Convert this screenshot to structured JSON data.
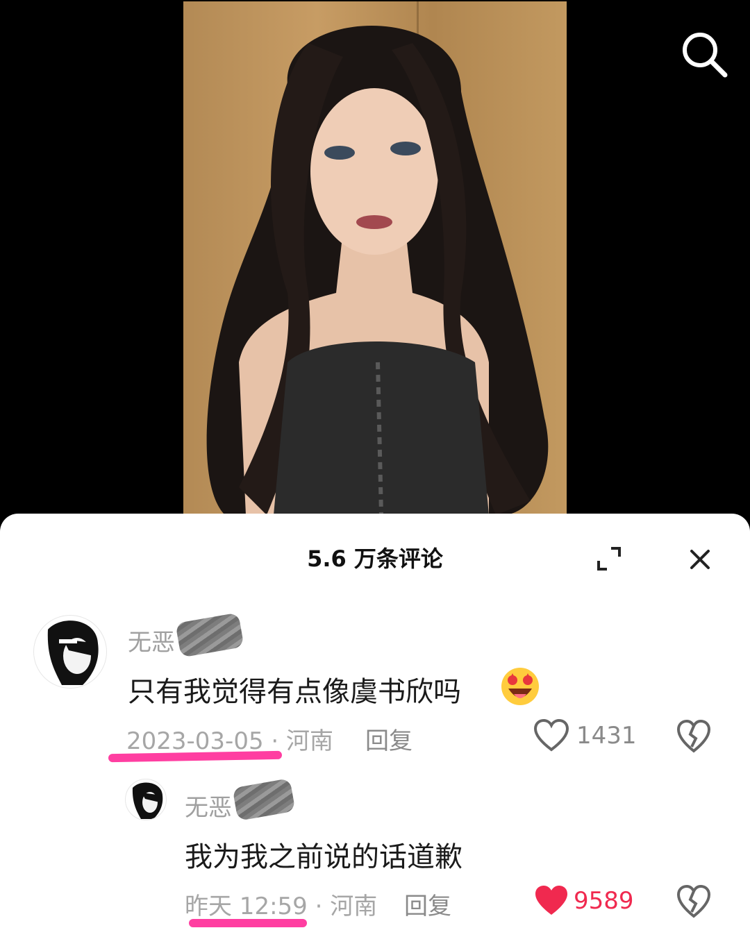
{
  "header": {
    "search_icon": "search-icon",
    "media": "portrait-photo"
  },
  "comments_sheet": {
    "title": "5.6 万条评论",
    "expand_icon": "expand-icon",
    "close_icon": "close-icon"
  },
  "comments": [
    {
      "username": "无恶",
      "text": "只有我觉得有点像虞书欣吗",
      "emoji": "star-struck-emoji",
      "date": "2023-03-05 · 河南",
      "reply_label": "回复",
      "likes": "1431",
      "liked": false
    }
  ],
  "replies": [
    {
      "username": "无恶",
      "text": "我为我之前说的话道歉",
      "date": "昨天 12:59 · 河南",
      "reply_label": "回复",
      "likes": "9589",
      "liked": true
    }
  ],
  "colors": {
    "like_active": "#f0294f",
    "highlight_underline": "#ff3ea1",
    "meta_gray": "#a6a6a6"
  }
}
